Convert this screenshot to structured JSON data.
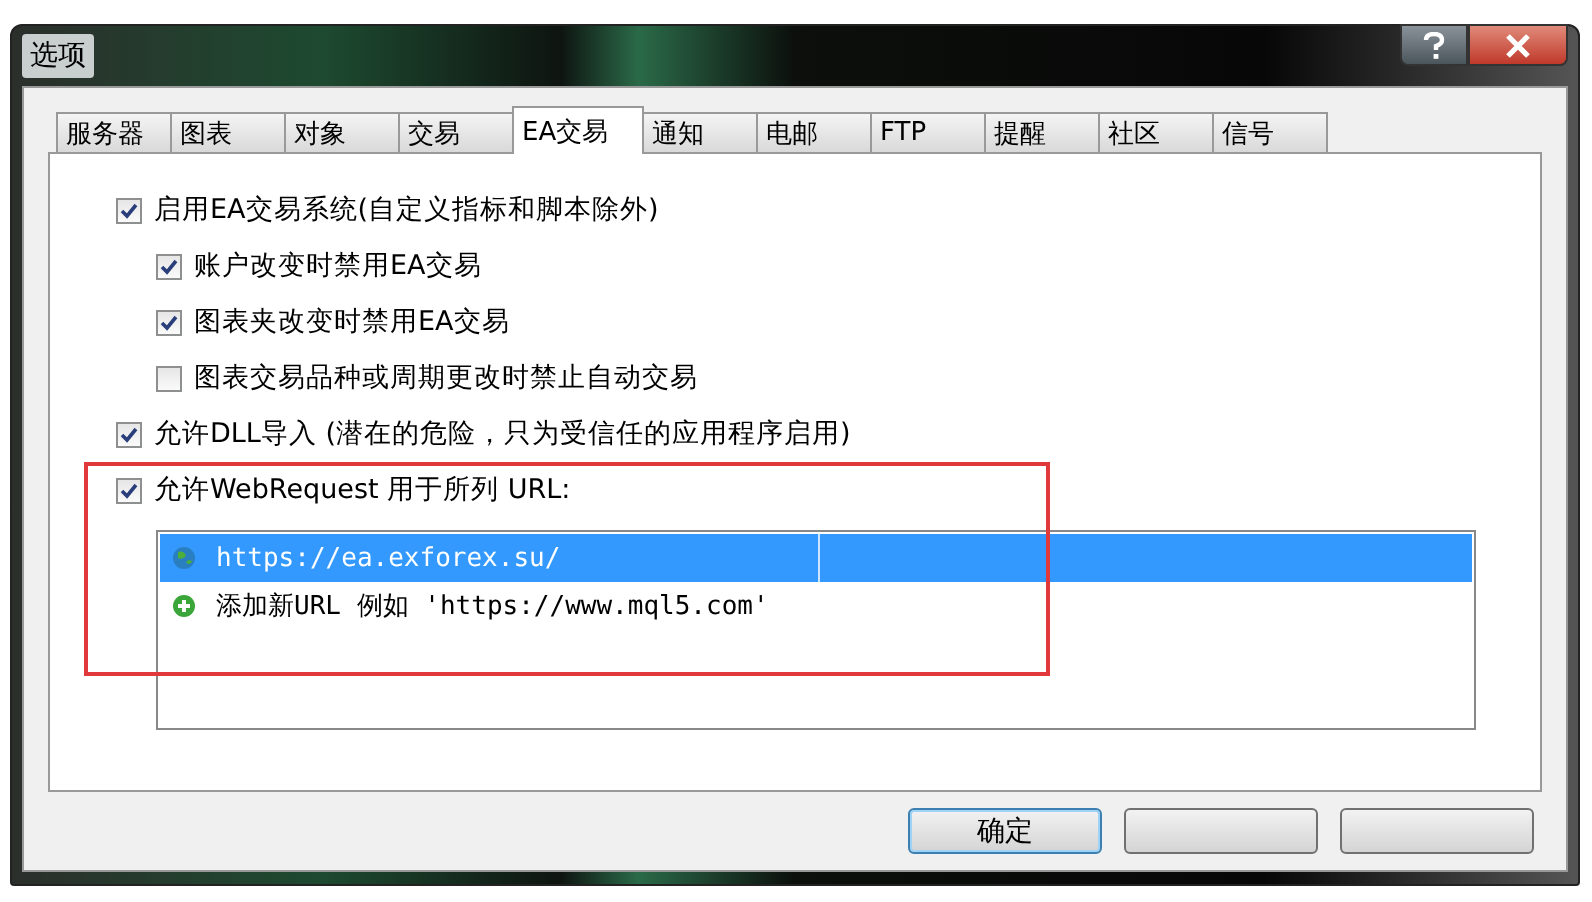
{
  "window": {
    "title": "选项"
  },
  "tabs": [
    {
      "label": "服务器",
      "selected": false
    },
    {
      "label": "图表",
      "selected": false
    },
    {
      "label": "对象",
      "selected": false
    },
    {
      "label": "交易",
      "selected": false
    },
    {
      "label": "EA交易",
      "selected": true
    },
    {
      "label": "通知",
      "selected": false
    },
    {
      "label": "电邮",
      "selected": false
    },
    {
      "label": "FTP",
      "selected": false
    },
    {
      "label": "提醒",
      "selected": false
    },
    {
      "label": "社区",
      "selected": false
    },
    {
      "label": "信号",
      "selected": false
    }
  ],
  "options": [
    {
      "label": "启用EA交易系统(自定义指标和脚本除外)",
      "checked": true,
      "children": [
        {
          "label": "账户改变时禁用EA交易",
          "checked": true
        },
        {
          "label": "图表夹改变时禁用EA交易",
          "checked": true
        },
        {
          "label": "图表交易品种或周期更改时禁止自动交易",
          "checked": false
        }
      ]
    },
    {
      "label": "允许DLL导入 (潜在的危险，只为受信任的应用程序启用)",
      "checked": true
    },
    {
      "label": "允许WebRequest 用于所列 URL:",
      "checked": true
    }
  ],
  "url_list": [
    {
      "kind": "url",
      "text": "https://ea.exforex.su/",
      "selected": true
    },
    {
      "kind": "add",
      "text": "添加新URL 例如 'https://www.mql5.com'",
      "selected": false
    }
  ],
  "buttons": [
    {
      "label": "确定",
      "default": true
    },
    {
      "default": false
    },
    {
      "default": false
    }
  ]
}
